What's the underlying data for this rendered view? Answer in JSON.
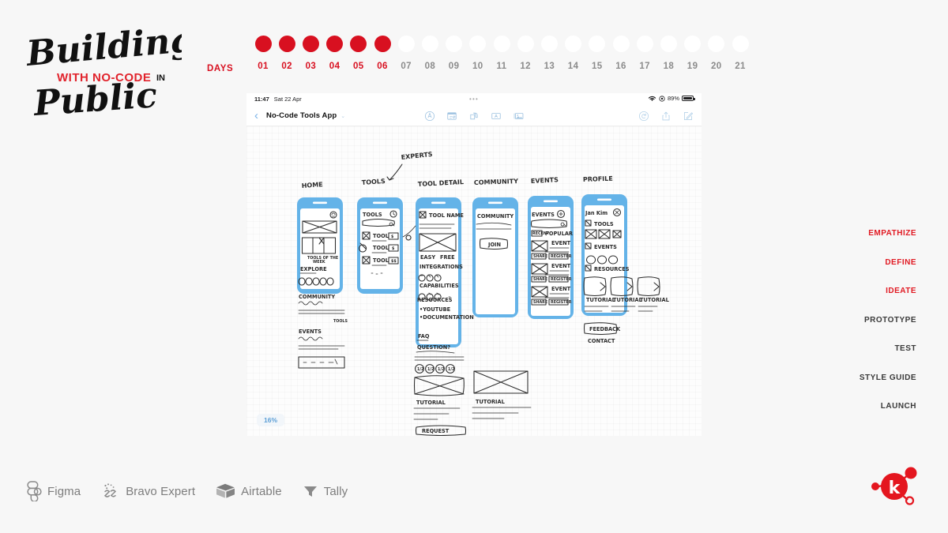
{
  "logo": {
    "line1": "Building",
    "badge": "WITH NO-CODE",
    "in": "IN",
    "line2": "Public"
  },
  "days": {
    "label": "DAYS",
    "items": [
      {
        "num": "01",
        "done": true
      },
      {
        "num": "02",
        "done": true
      },
      {
        "num": "03",
        "done": true
      },
      {
        "num": "04",
        "done": true
      },
      {
        "num": "05",
        "done": true
      },
      {
        "num": "06",
        "done": true
      },
      {
        "num": "07",
        "done": false
      },
      {
        "num": "08",
        "done": false
      },
      {
        "num": "09",
        "done": false
      },
      {
        "num": "10",
        "done": false
      },
      {
        "num": "11",
        "done": false
      },
      {
        "num": "12",
        "done": false
      },
      {
        "num": "13",
        "done": false
      },
      {
        "num": "14",
        "done": false
      },
      {
        "num": "15",
        "done": false
      },
      {
        "num": "16",
        "done": false
      },
      {
        "num": "17",
        "done": false
      },
      {
        "num": "18",
        "done": false
      },
      {
        "num": "19",
        "done": false
      },
      {
        "num": "20",
        "done": false
      },
      {
        "num": "21",
        "done": false
      }
    ],
    "done_color": "#d81020",
    "pending_color": "#8b8b8b"
  },
  "ipad": {
    "status": {
      "time": "11:47",
      "date": "Sat 22 Apr",
      "dots": "•••",
      "battery_pct": "89%"
    },
    "toolbar": {
      "back": "‹",
      "title": "No-Code Tools App",
      "caret": "⌄",
      "center_icons": [
        "markup-pen-icon",
        "sticky-note-icon",
        "shapes-icon",
        "text-box-icon",
        "photo-icon"
      ],
      "right_icons": [
        "undo-icon",
        "share-icon",
        "compose-icon"
      ]
    },
    "canvas": {
      "zoom": "16%",
      "screens": [
        {
          "title": "HOME",
          "items": [
            "NOTIFICATION",
            "TOOLS OF THE WEEK",
            "EXPLORE",
            "COMMUNITY",
            "EVENTS",
            "TOOLS"
          ]
        },
        {
          "title": "TOOLS",
          "items": [
            "TOOLS",
            "TOOL",
            "TOOL",
            "TOOL"
          ]
        },
        {
          "title": "TOOL DETAIL",
          "items": [
            "TOOL NAME",
            "EASY",
            "FREE",
            "INTEGRATIONS",
            "CAPABILITIES"
          ]
        },
        {
          "title": "COMMUNITY",
          "items": [
            "COMMUNITY",
            "JOIN"
          ]
        },
        {
          "title": "EVENTS",
          "items": [
            "EVENTS",
            "RECENT",
            "POPULAR",
            "EVENT",
            "SHARE",
            "REGISTER"
          ]
        },
        {
          "title": "PROFILE",
          "items": [
            "Jan Kim",
            "TOOLS",
            "EVENTS",
            "RESOURCES",
            "TUTORIAL",
            "FEEDBACK",
            "CONTACT"
          ]
        }
      ],
      "annotations": [
        "EXPERTS",
        "RESOURCES",
        "YOUTUBE",
        "DOCUMENTATION",
        "FAQ",
        "QUESTION?",
        "TUTORIAL",
        "TUTORIAL",
        "REQUEST"
      ],
      "phone_frame_color": "#64b3e8"
    }
  },
  "process": {
    "steps": [
      {
        "label": "EMPATHIZE",
        "active": true
      },
      {
        "label": "DEFINE",
        "active": true
      },
      {
        "label": "IDEATE",
        "active": true
      },
      {
        "label": "PROTOTYPE",
        "active": false
      },
      {
        "label": "TEST",
        "active": false
      },
      {
        "label": "STYLE GUIDE",
        "active": false
      },
      {
        "label": "LAUNCH",
        "active": false
      }
    ],
    "active_color": "#e11a23",
    "inactive_color": "#3a3a3a"
  },
  "tools": [
    {
      "label": "Figma",
      "icon": "figma-icon"
    },
    {
      "label": "Bravo Expert",
      "icon": "bravo-icon"
    },
    {
      "label": "Airtable",
      "icon": "airtable-icon"
    },
    {
      "label": "Tally",
      "icon": "tally-icon"
    }
  ],
  "brand": {
    "letter": "k",
    "color": "#e4161f"
  }
}
